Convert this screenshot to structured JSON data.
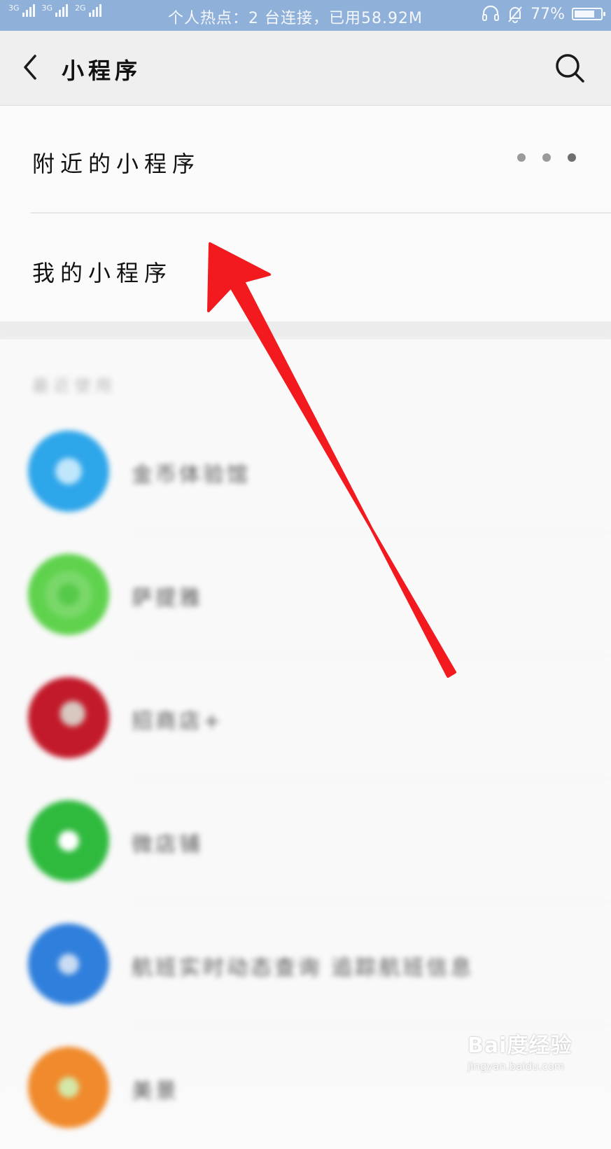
{
  "status_bar": {
    "signals": [
      "3G",
      "3G",
      "2G"
    ],
    "center_text": "个人热点：2 台连接，已用58.92M",
    "battery": "77%",
    "battery_level": 0.77
  },
  "header": {
    "title": "小程序",
    "back_icon": "chevron-left-icon",
    "search_icon": "search-icon"
  },
  "menu": {
    "nearby_label": "附近的小程序",
    "mine_label": "我的小程序"
  },
  "recent": {
    "section_label": "最近使用",
    "items": [
      {
        "name": "金币体验馆"
      },
      {
        "name": "萨提雅"
      },
      {
        "name": "招商店+"
      },
      {
        "name": "微店铺"
      },
      {
        "name": "航班实时动态查询 追踪航班信息"
      },
      {
        "name": "美景"
      }
    ]
  },
  "watermark": {
    "main": "Bai度经验",
    "sub": "jingyan.baidu.com"
  },
  "colors": {
    "status_bar": "#8fb0d8",
    "header_bg": "#efefef",
    "annotation_arrow": "#f21a1f"
  }
}
